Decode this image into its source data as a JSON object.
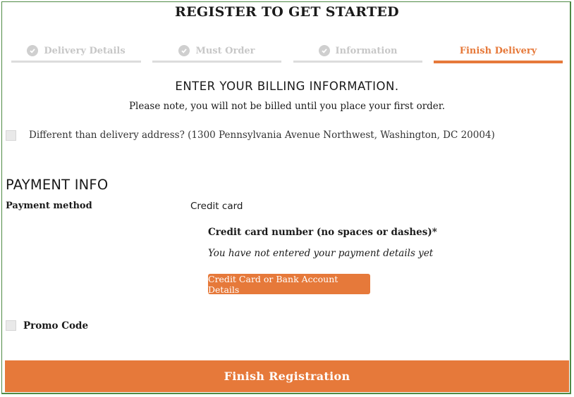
{
  "page": {
    "title": "REGISTER TO GET STARTED"
  },
  "steps": [
    {
      "label": "Delivery Details",
      "state": "done"
    },
    {
      "label": "Must Order",
      "state": "done"
    },
    {
      "label": "Information",
      "state": "done"
    },
    {
      "label": "Finish Delivery",
      "state": "active"
    }
  ],
  "billing": {
    "heading": "ENTER YOUR BILLING INFORMATION.",
    "note": "Please note, you will not be billed until you place your first order.",
    "different_address_label": "Different than delivery address? (1300 Pennsylvania Avenue Northwest, Washington, DC 20004)",
    "different_address_checked": false
  },
  "payment": {
    "heading": "PAYMENT INFO",
    "method_label": "Payment method",
    "method_value": "Credit card",
    "cc_number_label": "Credit card number (no spaces or dashes)*",
    "cc_status": "You have not entered your payment details yet",
    "details_button_label": "Credit Card or Bank Account Details"
  },
  "promo": {
    "label": "Promo Code",
    "checked": false
  },
  "actions": {
    "finish_label": "Finish Registration"
  },
  "colors": {
    "accent": "#e6793a",
    "inactive_step": "#c7c7c7",
    "frame_border": "#4f8a45"
  }
}
